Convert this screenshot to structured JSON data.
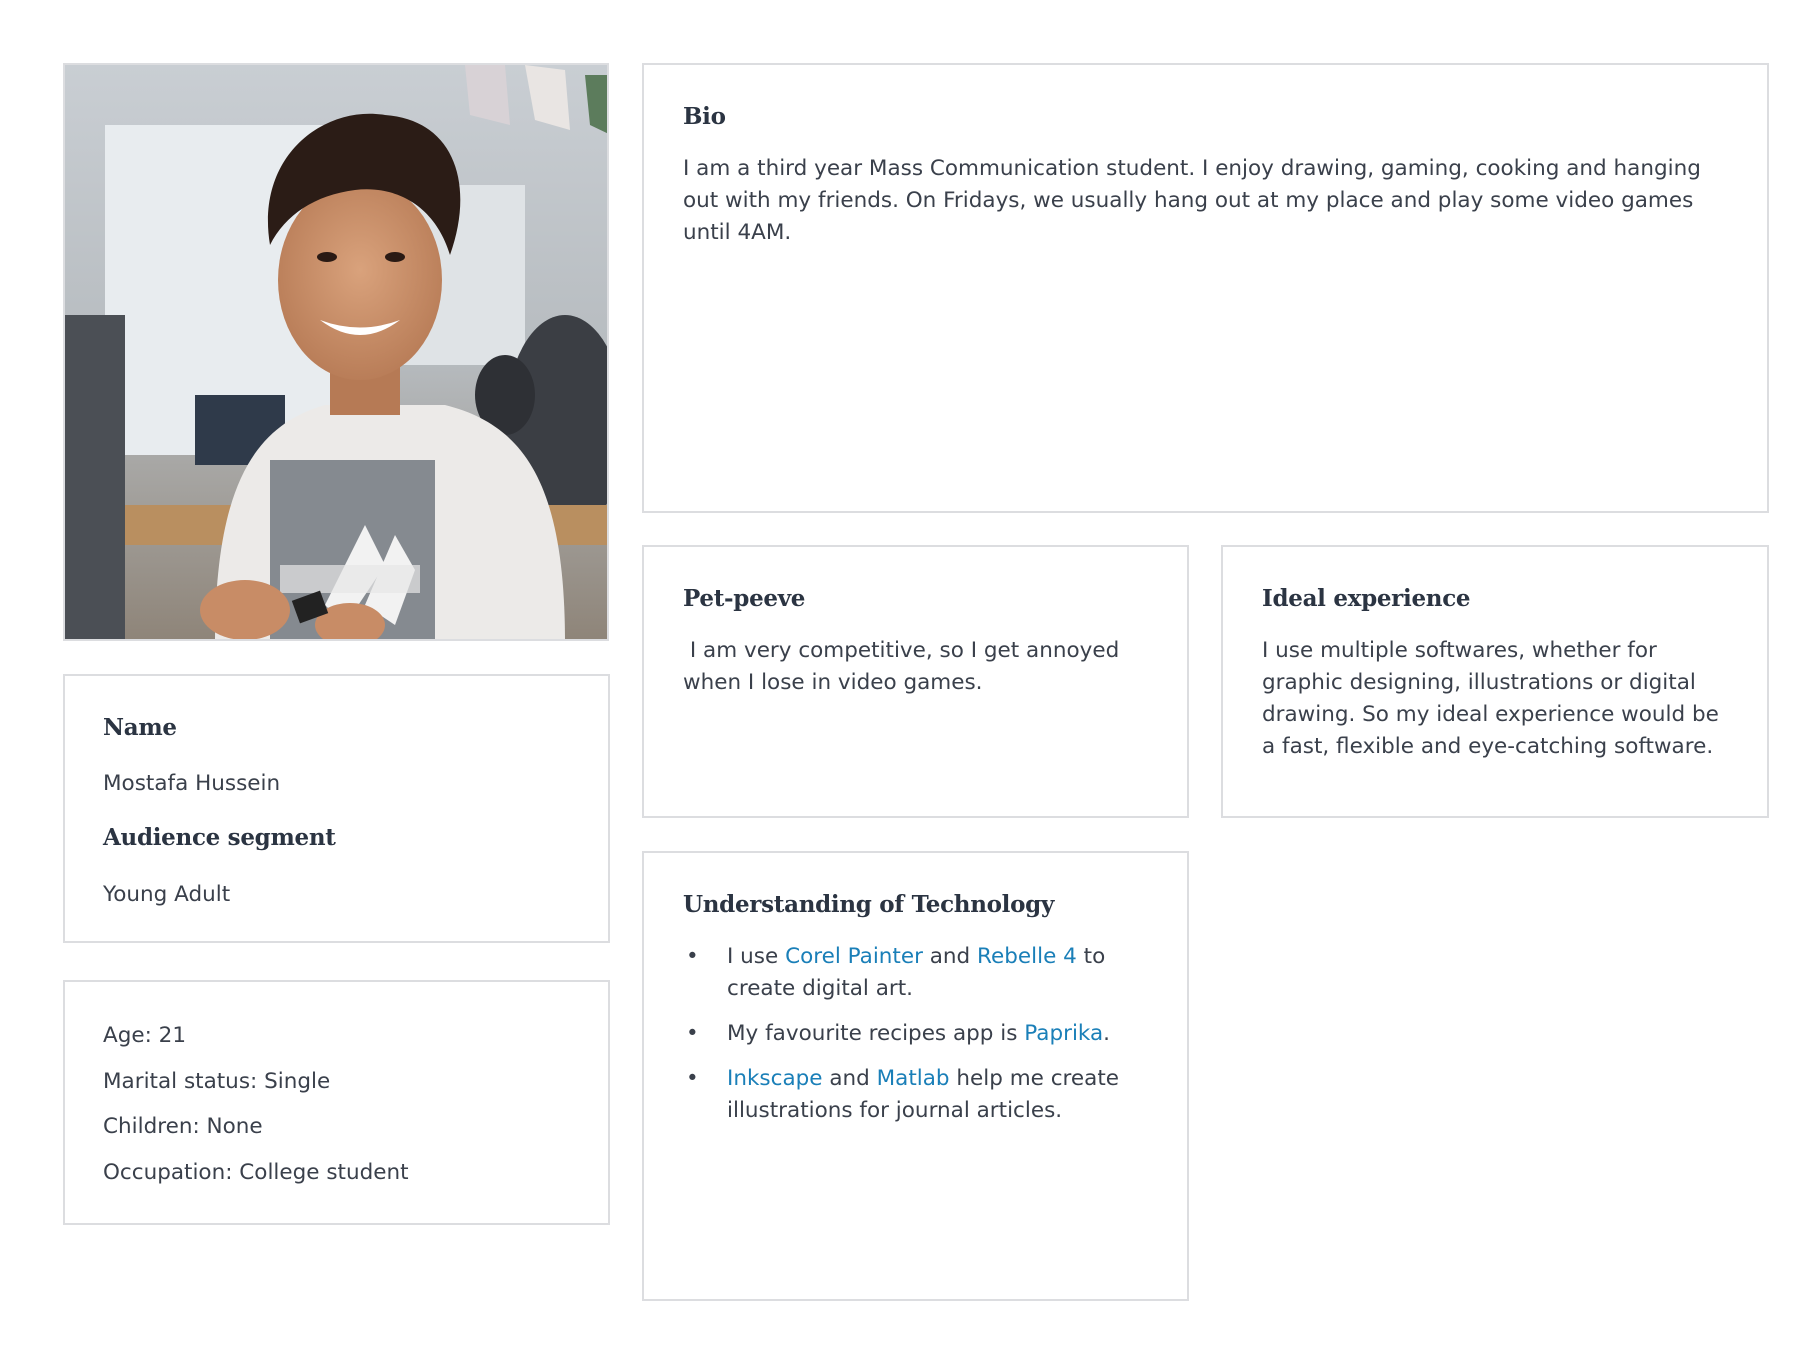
{
  "profile": {
    "name_heading": "Name",
    "name_value": "Mostafa Hussein",
    "segment_heading": "Audience segment",
    "segment_value": "Young Adult"
  },
  "facts": [
    "Age: 21",
    "Marital status: Single",
    "Children: None",
    "Occupation: College student"
  ],
  "bio": {
    "heading": "Bio",
    "text": "I am a third year Mass Communication student. I enjoy drawing, gaming, cooking and hanging out with my friends. On Fridays, we usually hang out at my place and play some video games until 4AM."
  },
  "pet_peeve": {
    "heading": "Pet-peeve",
    "text": " I am very competitive, so I get annoyed when I lose in video games."
  },
  "ideal_experience": {
    "heading": "Ideal experience",
    "text": "I use multiple softwares, whether for graphic designing, illustrations or digital drawing. So my ideal experience would be a fast, flexible and eye-catching software."
  },
  "technology": {
    "heading": "Understanding of Technology",
    "bullet": "•",
    "items": [
      {
        "t1": "I use ",
        "l1": "Corel Painter",
        "t2": " and ",
        "l2": "Rebelle 4",
        "t3": " to create digital art."
      },
      {
        "t1": "My favourite recipes app is ",
        "l1": "Paprika",
        "t2": "."
      },
      {
        "l1": "Inkscape",
        "t2": " and ",
        "l2": "Matlab",
        "t3": " help me create illustrations for journal articles."
      }
    ]
  },
  "colors": {
    "link": "#1a7fb8",
    "border": "#dcdde0",
    "text": "#3a404b",
    "heading": "#2b3442"
  }
}
